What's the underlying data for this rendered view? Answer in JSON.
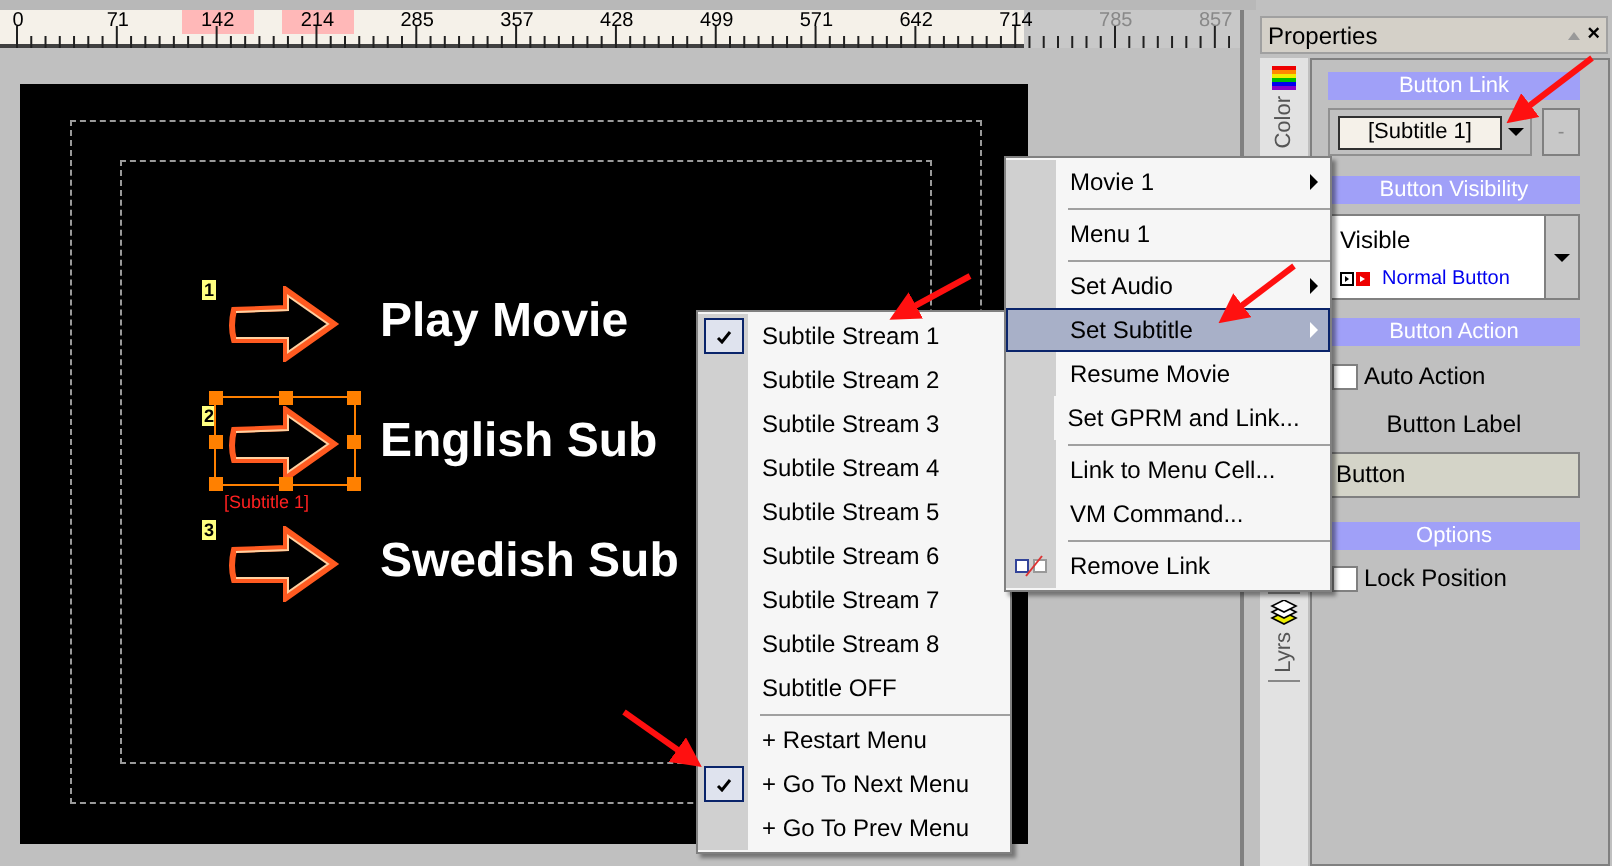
{
  "ruler": {
    "labels": [
      {
        "text": "0",
        "in_selection": false,
        "disabled": false
      },
      {
        "text": "71",
        "in_selection": false,
        "disabled": false
      },
      {
        "text": "142",
        "in_selection": true,
        "disabled": false
      },
      {
        "text": "214",
        "in_selection": true,
        "disabled": false
      },
      {
        "text": "285",
        "in_selection": false,
        "disabled": false
      },
      {
        "text": "357",
        "in_selection": false,
        "disabled": false
      },
      {
        "text": "428",
        "in_selection": false,
        "disabled": false
      },
      {
        "text": "499",
        "in_selection": false,
        "disabled": false
      },
      {
        "text": "571",
        "in_selection": false,
        "disabled": false
      },
      {
        "text": "642",
        "in_selection": false,
        "disabled": false
      },
      {
        "text": "714",
        "in_selection": false,
        "disabled": false
      },
      {
        "text": "785",
        "in_selection": false,
        "disabled": true
      },
      {
        "text": "857",
        "in_selection": false,
        "disabled": true
      }
    ]
  },
  "menu_buttons": [
    {
      "number": "1",
      "text": "Play Movie",
      "selected": false
    },
    {
      "number": "2",
      "text": "English Sub",
      "selected": true,
      "link_tag": "[Subtitle 1]"
    },
    {
      "number": "3",
      "text": "Swedish Sub",
      "selected": false
    }
  ],
  "context_menu": {
    "items": [
      {
        "label": "Movie 1",
        "has_submenu": true,
        "selected": false,
        "separator_before": false
      },
      {
        "label": "Menu 1",
        "has_submenu": false,
        "selected": false,
        "separator_before": true
      },
      {
        "label": "Set Audio",
        "has_submenu": true,
        "selected": false,
        "separator_before": true
      },
      {
        "label": "Set Subtitle",
        "has_submenu": true,
        "selected": true,
        "separator_before": false
      },
      {
        "label": "Resume Movie",
        "has_submenu": false,
        "selected": false,
        "separator_before": false
      },
      {
        "label": "Set GPRM and Link...",
        "has_submenu": false,
        "selected": false,
        "separator_before": false
      },
      {
        "label": "Link to Menu Cell...",
        "has_submenu": false,
        "selected": false,
        "separator_before": true
      },
      {
        "label": "VM Command...",
        "has_submenu": false,
        "selected": false,
        "separator_before": false
      },
      {
        "label": "Remove Link",
        "has_submenu": false,
        "selected": false,
        "separator_before": true,
        "kind": "unlink"
      }
    ]
  },
  "submenu": {
    "items": [
      {
        "label": "Subtile Stream 1",
        "checked": true,
        "separator_before": false
      },
      {
        "label": "Subtile Stream 2",
        "checked": false,
        "separator_before": false
      },
      {
        "label": "Subtile Stream 3",
        "checked": false,
        "separator_before": false
      },
      {
        "label": "Subtile Stream 4",
        "checked": false,
        "separator_before": false
      },
      {
        "label": "Subtile Stream 5",
        "checked": false,
        "separator_before": false
      },
      {
        "label": "Subtile Stream 6",
        "checked": false,
        "separator_before": false
      },
      {
        "label": "Subtile Stream 7",
        "checked": false,
        "separator_before": false
      },
      {
        "label": "Subtile Stream 8",
        "checked": false,
        "separator_before": false
      },
      {
        "label": "Subtitle OFF",
        "checked": false,
        "separator_before": false
      },
      {
        "label": "+ Restart Menu",
        "checked": false,
        "separator_before": true
      },
      {
        "label": "+ Go To Next Menu",
        "checked": true,
        "separator_before": false
      },
      {
        "label": "+ Go To Prev Menu",
        "checked": false,
        "separator_before": false
      }
    ]
  },
  "properties": {
    "title": "Properties",
    "close": "×",
    "side_tabs": [
      {
        "label": "Color"
      },
      {
        "label": "Lyrs"
      }
    ],
    "button_link": {
      "header": "Button Link",
      "value": "[Subtitle 1]",
      "side_button": "-"
    },
    "button_visibility": {
      "header": "Button Visibility",
      "value": "Visible",
      "state": "Normal Button"
    },
    "button_action": {
      "header": "Button Action",
      "auto_action": {
        "label": "Auto Action",
        "checked": false
      }
    },
    "button_label": {
      "label": "Button Label",
      "value": "Button"
    },
    "options": {
      "header": "Options",
      "lock_position": {
        "label": "Lock Position",
        "checked": false
      }
    }
  }
}
